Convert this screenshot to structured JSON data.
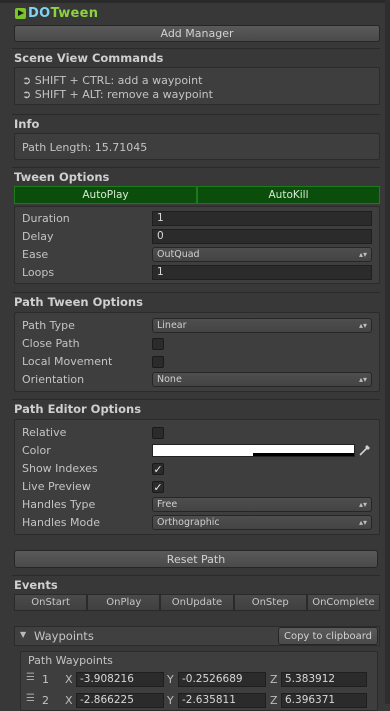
{
  "logo": {
    "part1": "DO",
    "part2": "Tween"
  },
  "add_manager_label": "Add Manager",
  "scene_view": {
    "title": "Scene View Commands",
    "lines": [
      "➲ SHIFT + CTRL: add a waypoint",
      "➲ SHIFT + ALT: remove a waypoint"
    ]
  },
  "info": {
    "title": "Info",
    "path_length": "Path Length: 15.71045"
  },
  "tween_options": {
    "title": "Tween Options",
    "autoplay": "AutoPlay",
    "autokill": "AutoKill",
    "rows": [
      {
        "label": "Duration",
        "value": "1"
      },
      {
        "label": "Delay",
        "value": "0"
      },
      {
        "label": "Ease",
        "value": "OutQuad"
      },
      {
        "label": "Loops",
        "value": "1"
      }
    ]
  },
  "path_tween_options": {
    "title": "Path Tween Options",
    "path_type_label": "Path Type",
    "path_type_value": "Linear",
    "close_path_label": "Close Path",
    "local_movement_label": "Local Movement",
    "orientation_label": "Orientation",
    "orientation_value": "None"
  },
  "path_editor_options": {
    "title": "Path Editor Options",
    "relative_label": "Relative",
    "color_label": "Color",
    "show_indexes_label": "Show Indexes",
    "live_preview_label": "Live Preview",
    "handles_type_label": "Handles Type",
    "handles_type_value": "Free",
    "handles_mode_label": "Handles Mode",
    "handles_mode_value": "Orthographic",
    "checks": {
      "relative": false,
      "show_indexes": true,
      "live_preview": true
    }
  },
  "reset_path_label": "Reset Path",
  "events": {
    "title": "Events",
    "buttons": [
      "OnStart",
      "OnPlay",
      "OnUpdate",
      "OnStep",
      "OnComplete"
    ]
  },
  "waypoints": {
    "title": "Waypoints",
    "copy_label": "Copy to clipboard",
    "sub_title": "Path Waypoints",
    "rows": [
      {
        "index": "1",
        "x": "-3.908216",
        "y": "-0.2526689",
        "z": "5.383912"
      },
      {
        "index": "2",
        "x": "-2.866225",
        "y": "-2.635811",
        "z": "6.396371"
      }
    ],
    "axis": {
      "x": "X",
      "y": "Y",
      "z": "Z"
    }
  },
  "colors": {
    "accent_green": "#0b4e0b",
    "bg": "#383838"
  }
}
